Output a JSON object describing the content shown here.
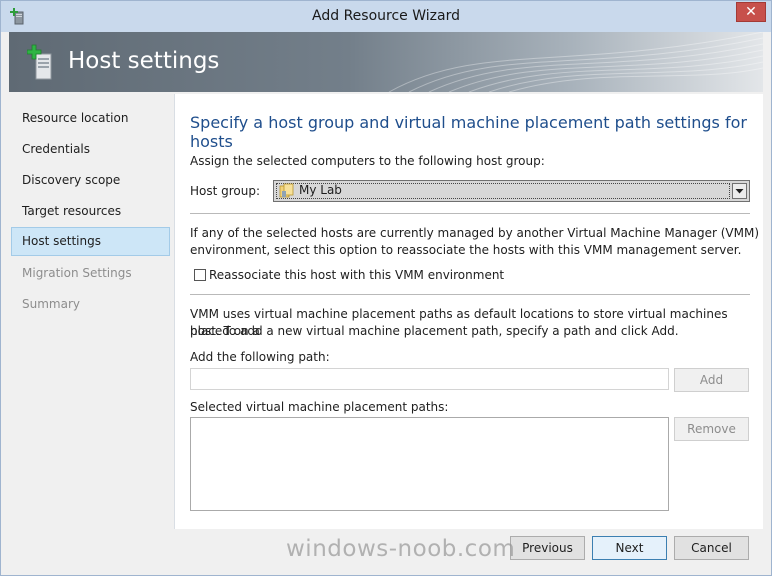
{
  "window": {
    "title": "Add Resource Wizard",
    "close_glyph": "✕"
  },
  "header": {
    "title": "Host settings",
    "icon": "add-server-icon"
  },
  "nav": {
    "items": [
      {
        "label": "Resource location",
        "state": "normal"
      },
      {
        "label": "Credentials",
        "state": "normal"
      },
      {
        "label": "Discovery scope",
        "state": "normal"
      },
      {
        "label": "Target resources",
        "state": "normal"
      },
      {
        "label": "Host settings",
        "state": "active"
      },
      {
        "label": "Migration Settings",
        "state": "disabled"
      },
      {
        "label": "Summary",
        "state": "disabled"
      }
    ]
  },
  "main": {
    "heading": "Specify a host group and virtual machine placement path settings for hosts",
    "assign_text": "Assign the selected computers to the following host group:",
    "host_group_label": "Host group:",
    "host_group_value": "My Lab",
    "vmm_text_line1": "If any of the selected hosts are currently managed by another Virtual Machine Manager (VMM)",
    "vmm_text_line2": "environment, select this option to reassociate the hosts with this VMM management server.",
    "reassociate_label": "Reassociate this host with this VMM environment",
    "reassociate_checked": false,
    "placement_text_line1": "VMM uses virtual machine placement paths as default locations to store virtual machines placed on a",
    "placement_text_line2": "host. To add a new virtual machine placement path, specify a path and click Add.",
    "add_path_label": "Add the following path:",
    "add_path_value": "",
    "add_button": "Add",
    "selected_paths_label": "Selected virtual machine placement paths:",
    "selected_paths": [],
    "remove_button": "Remove"
  },
  "footer": {
    "previous": "Previous",
    "next": "Next",
    "cancel": "Cancel"
  },
  "watermark": "windows-noob.com",
  "colors": {
    "heading": "#1f4e8c",
    "titlebar": "#c9d9ec",
    "close": "#c7504b",
    "nav_active": "#cde6f7"
  }
}
